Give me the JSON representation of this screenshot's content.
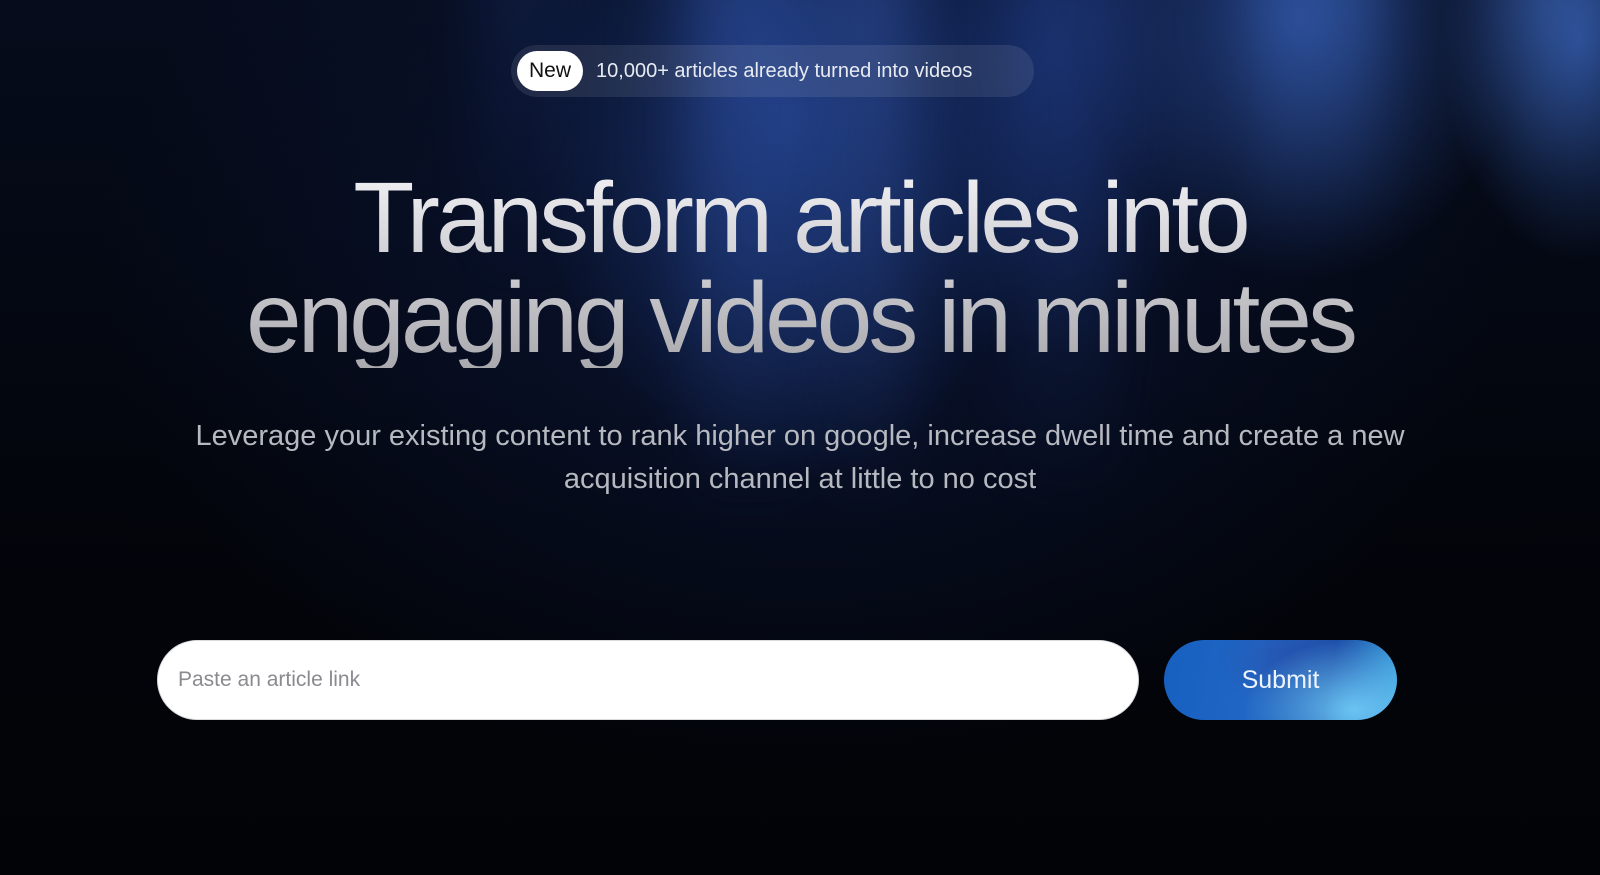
{
  "announcement": {
    "badge": "New",
    "text": "10,000+ articles already turned into videos"
  },
  "hero": {
    "headline_line1": "Transform articles into",
    "headline_line2": "engaging videos in minutes",
    "subheadline": "Leverage your existing content to rank higher on google, increase dwell time and create a new acquisition channel at little to no cost"
  },
  "form": {
    "input_placeholder": "Paste an article link",
    "input_value": "",
    "submit_label": "Submit"
  },
  "colors": {
    "background": "#020306",
    "accent_blue": "#1660c0",
    "accent_light_blue": "#6ec8f5",
    "headline": "#d4d4d8"
  }
}
